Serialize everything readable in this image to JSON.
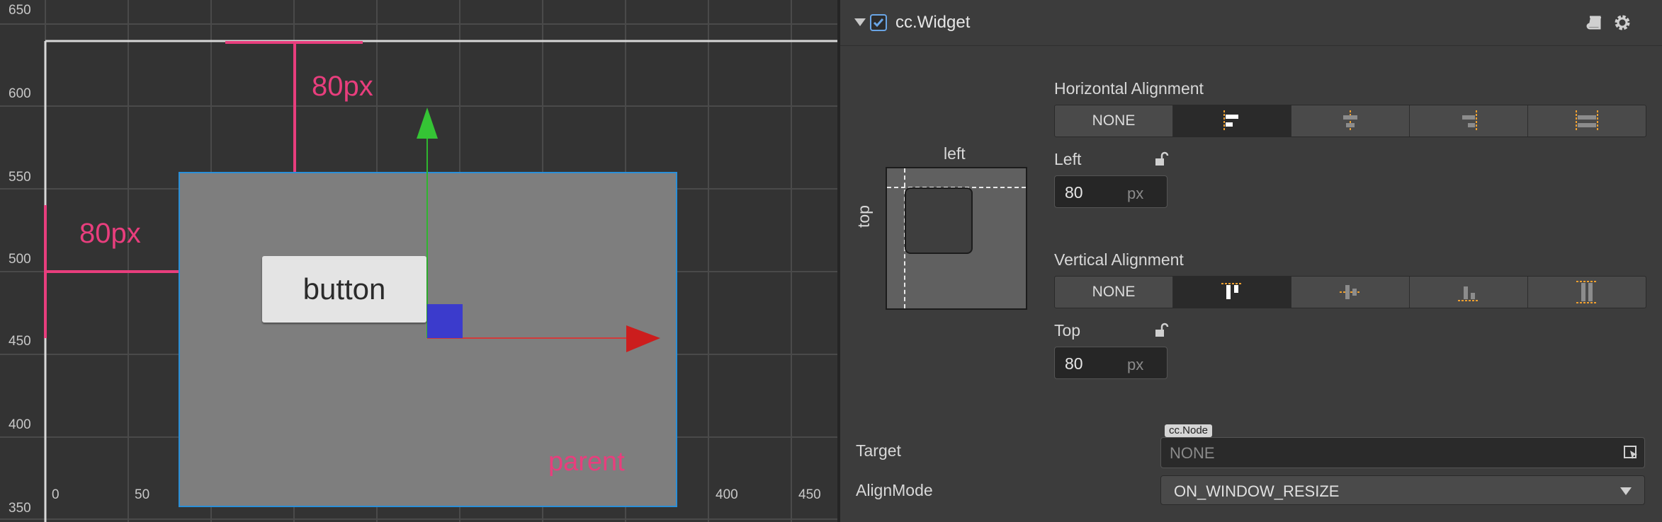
{
  "scene": {
    "y_ticks": [
      "650",
      "600",
      "550",
      "500",
      "450",
      "400",
      "350"
    ],
    "x_ticks": [
      "0",
      "50",
      "400",
      "450"
    ],
    "top_margin_label": "80px",
    "left_margin_label": "80px",
    "button_label": "button",
    "parent_label": "parent"
  },
  "inspector": {
    "component_title": "cc.Widget",
    "component_enabled": true,
    "horizontal": {
      "title": "Horizontal Alignment",
      "options": [
        "NONE",
        "align-left-icon",
        "align-center-icon",
        "align-right-icon",
        "stretch-horizontal-icon"
      ],
      "selected_index": 1,
      "none_label": "NONE"
    },
    "left": {
      "label": "Left",
      "value": "80",
      "unit": "px"
    },
    "vertical": {
      "title": "Vertical Alignment",
      "options": [
        "NONE",
        "align-top-icon",
        "align-middle-icon",
        "align-bottom-icon",
        "stretch-vertical-icon"
      ],
      "selected_index": 1,
      "none_label": "NONE"
    },
    "top": {
      "label": "Top",
      "value": "80",
      "unit": "px"
    },
    "preview": {
      "left_label": "left",
      "top_label": "top"
    },
    "target": {
      "label": "Target",
      "type_tag": "cc.Node",
      "value": "NONE"
    },
    "align_mode": {
      "label": "AlignMode",
      "value": "ON_WINDOW_RESIZE"
    }
  },
  "colors": {
    "accent_magenta": "#e83e7d",
    "selection_blue": "#2b8fd8",
    "dim_orange": "#f0a030"
  }
}
